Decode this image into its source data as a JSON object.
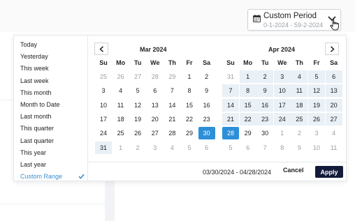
{
  "trigger": {
    "title": "Custom Period",
    "subtitle": "0-1-2024 - 59-2-2024"
  },
  "presets": [
    {
      "label": "Today",
      "active": false
    },
    {
      "label": "Yesterday",
      "active": false
    },
    {
      "label": "This week",
      "active": false
    },
    {
      "label": "Last week",
      "active": false
    },
    {
      "label": "This month",
      "active": false
    },
    {
      "label": "Month to Date",
      "active": false
    },
    {
      "label": "Last month",
      "active": false
    },
    {
      "label": "This quarter",
      "active": false
    },
    {
      "label": "Last quarter",
      "active": false
    },
    {
      "label": "This year",
      "active": false
    },
    {
      "label": "Last year",
      "active": false
    },
    {
      "label": "Custom Range",
      "active": true
    }
  ],
  "weekdays": [
    "Su",
    "Mo",
    "Tu",
    "We",
    "Th",
    "Fr",
    "Sa"
  ],
  "calendars": [
    {
      "title": "Mar 2024",
      "days": [
        {
          "d": "25",
          "state": "muted"
        },
        {
          "d": "26",
          "state": "muted"
        },
        {
          "d": "27",
          "state": "muted"
        },
        {
          "d": "28",
          "state": "muted"
        },
        {
          "d": "29",
          "state": "muted"
        },
        {
          "d": "1",
          "state": ""
        },
        {
          "d": "2",
          "state": ""
        },
        {
          "d": "3",
          "state": ""
        },
        {
          "d": "4",
          "state": ""
        },
        {
          "d": "5",
          "state": ""
        },
        {
          "d": "6",
          "state": ""
        },
        {
          "d": "7",
          "state": ""
        },
        {
          "d": "8",
          "state": ""
        },
        {
          "d": "9",
          "state": ""
        },
        {
          "d": "10",
          "state": ""
        },
        {
          "d": "11",
          "state": ""
        },
        {
          "d": "12",
          "state": ""
        },
        {
          "d": "13",
          "state": ""
        },
        {
          "d": "14",
          "state": ""
        },
        {
          "d": "15",
          "state": ""
        },
        {
          "d": "16",
          "state": ""
        },
        {
          "d": "17",
          "state": ""
        },
        {
          "d": "18",
          "state": ""
        },
        {
          "d": "19",
          "state": ""
        },
        {
          "d": "20",
          "state": ""
        },
        {
          "d": "21",
          "state": ""
        },
        {
          "d": "22",
          "state": ""
        },
        {
          "d": "23",
          "state": ""
        },
        {
          "d": "24",
          "state": ""
        },
        {
          "d": "25",
          "state": ""
        },
        {
          "d": "26",
          "state": ""
        },
        {
          "d": "27",
          "state": ""
        },
        {
          "d": "28",
          "state": ""
        },
        {
          "d": "29",
          "state": ""
        },
        {
          "d": "30",
          "state": "sel"
        },
        {
          "d": "31",
          "state": "inrange"
        },
        {
          "d": "1",
          "state": "muted"
        },
        {
          "d": "2",
          "state": "muted"
        },
        {
          "d": "3",
          "state": "muted"
        },
        {
          "d": "4",
          "state": "muted"
        },
        {
          "d": "5",
          "state": "muted"
        },
        {
          "d": "6",
          "state": "muted"
        }
      ]
    },
    {
      "title": "Apr 2024",
      "days": [
        {
          "d": "31",
          "state": "muted"
        },
        {
          "d": "1",
          "state": "inrange"
        },
        {
          "d": "2",
          "state": "inrange"
        },
        {
          "d": "3",
          "state": "inrange"
        },
        {
          "d": "4",
          "state": "inrange"
        },
        {
          "d": "5",
          "state": "inrange"
        },
        {
          "d": "6",
          "state": "inrange"
        },
        {
          "d": "7",
          "state": "inrange"
        },
        {
          "d": "8",
          "state": "inrange"
        },
        {
          "d": "9",
          "state": "inrange"
        },
        {
          "d": "10",
          "state": "inrange"
        },
        {
          "d": "11",
          "state": "inrange"
        },
        {
          "d": "12",
          "state": "inrange"
        },
        {
          "d": "13",
          "state": "inrange"
        },
        {
          "d": "14",
          "state": "inrange"
        },
        {
          "d": "15",
          "state": "inrange"
        },
        {
          "d": "16",
          "state": "inrange"
        },
        {
          "d": "17",
          "state": "inrange"
        },
        {
          "d": "18",
          "state": "inrange"
        },
        {
          "d": "19",
          "state": "inrange"
        },
        {
          "d": "20",
          "state": "inrange"
        },
        {
          "d": "21",
          "state": "inrange"
        },
        {
          "d": "22",
          "state": "inrange"
        },
        {
          "d": "23",
          "state": "inrange"
        },
        {
          "d": "24",
          "state": "inrange"
        },
        {
          "d": "25",
          "state": "inrange"
        },
        {
          "d": "26",
          "state": "inrange"
        },
        {
          "d": "27",
          "state": "inrange"
        },
        {
          "d": "28",
          "state": "sel"
        },
        {
          "d": "29",
          "state": ""
        },
        {
          "d": "30",
          "state": ""
        },
        {
          "d": "1",
          "state": "muted"
        },
        {
          "d": "2",
          "state": "muted"
        },
        {
          "d": "3",
          "state": "muted"
        },
        {
          "d": "4",
          "state": "muted"
        },
        {
          "d": "5",
          "state": "muted"
        },
        {
          "d": "6",
          "state": "muted"
        },
        {
          "d": "7",
          "state": "muted"
        },
        {
          "d": "8",
          "state": "muted"
        },
        {
          "d": "9",
          "state": "muted"
        },
        {
          "d": "10",
          "state": "muted"
        },
        {
          "d": "11",
          "state": "muted"
        }
      ]
    }
  ],
  "footer": {
    "range": "03/30/2024 - 04/28/2024",
    "cancel_label": "Cancel",
    "apply_label": "Apply"
  },
  "colors": {
    "accent": "#2d8fd8",
    "range_bg": "#e9f0f6",
    "apply_bg": "#141a3a",
    "active_preset": "#3c8fd1"
  }
}
